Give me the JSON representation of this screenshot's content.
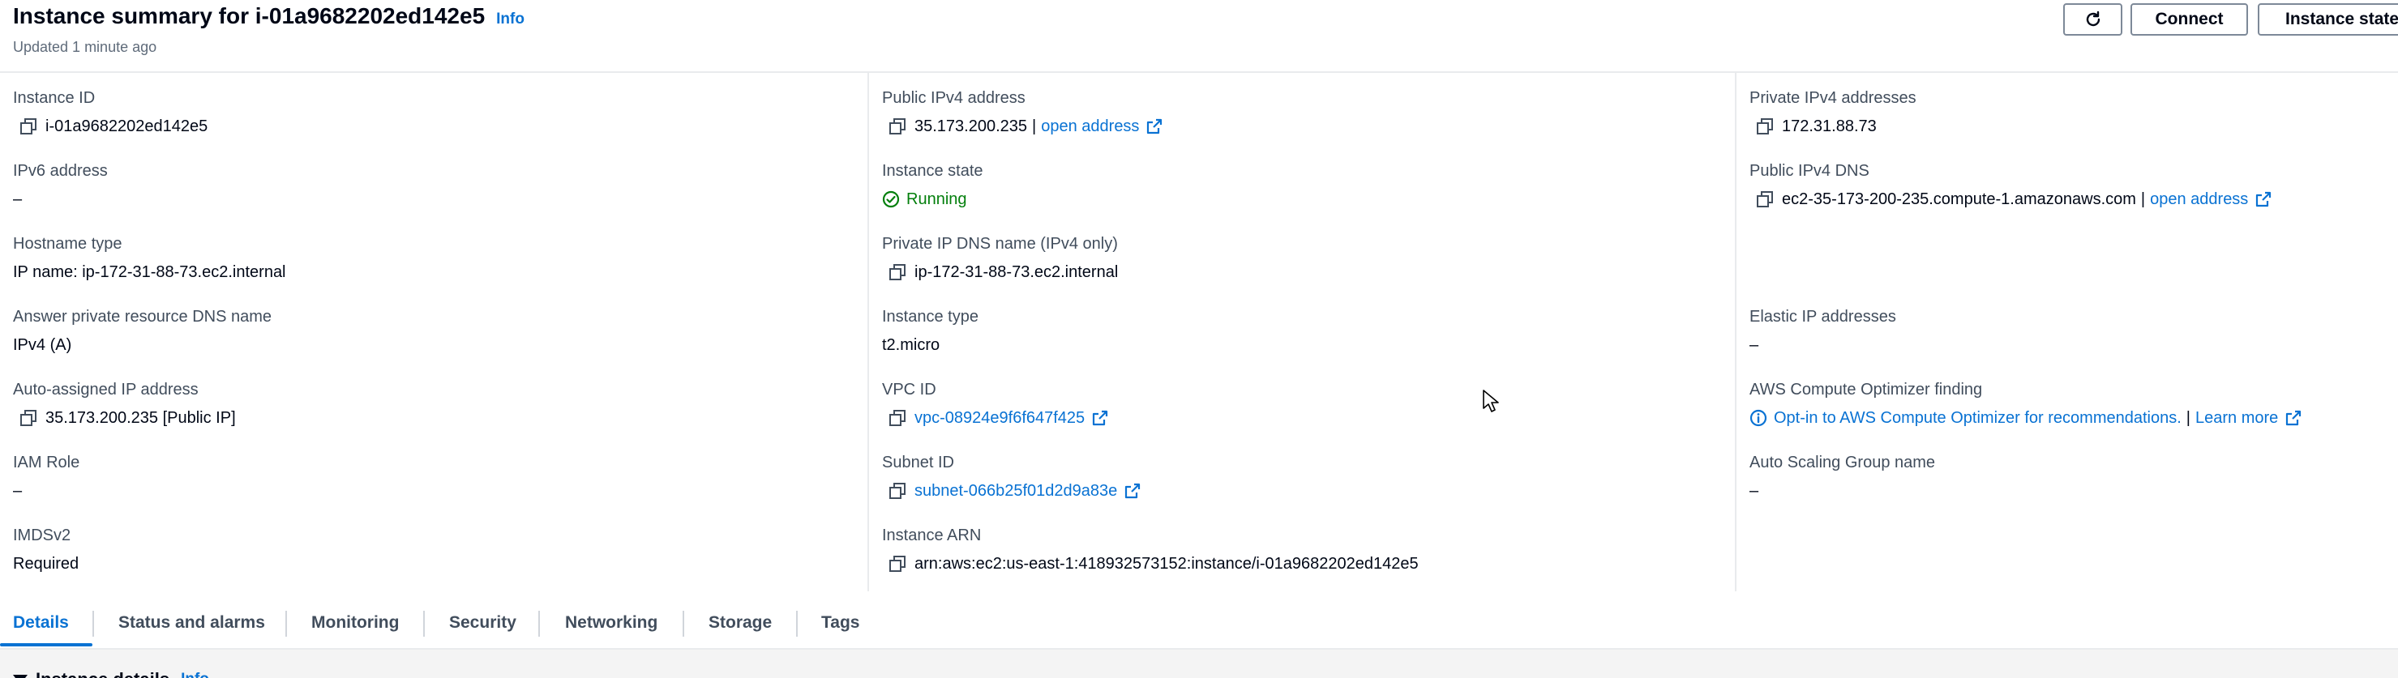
{
  "header": {
    "title": "Instance summary for i-01a9682202ed142e5",
    "info_link": "Info",
    "updated": "Updated 1 minute ago",
    "buttons": {
      "refresh_icon": "refresh-icon",
      "connect": "Connect",
      "instance_state": "Instance state"
    }
  },
  "fields": {
    "instance_id": {
      "label": "Instance ID",
      "value": "i-01a9682202ed142e5"
    },
    "ipv6_address": {
      "label": "IPv6 address",
      "value": "–"
    },
    "hostname_type": {
      "label": "Hostname type",
      "value": "IP name: ip-172-31-88-73.ec2.internal"
    },
    "answer_private_dns": {
      "label": "Answer private resource DNS name",
      "value": "IPv4 (A)"
    },
    "auto_assigned_ip": {
      "label": "Auto-assigned IP address",
      "value": "35.173.200.235 [Public IP]"
    },
    "iam_role": {
      "label": "IAM Role",
      "value": "–"
    },
    "imdsv2": {
      "label": "IMDSv2",
      "value": "Required"
    },
    "public_ipv4": {
      "label": "Public IPv4 address",
      "value": "35.173.200.235",
      "separator": "|",
      "link": "open address"
    },
    "instance_state": {
      "label": "Instance state",
      "value": "Running"
    },
    "private_ip_dns": {
      "label": "Private IP DNS name (IPv4 only)",
      "value": "ip-172-31-88-73.ec2.internal"
    },
    "instance_type": {
      "label": "Instance type",
      "value": "t2.micro"
    },
    "vpc_id": {
      "label": "VPC ID",
      "link": "vpc-08924e9f6f647f425"
    },
    "subnet_id": {
      "label": "Subnet ID",
      "link": "subnet-066b25f01d2d9a83e"
    },
    "instance_arn": {
      "label": "Instance ARN",
      "value": "arn:aws:ec2:us-east-1:418932573152:instance/i-01a9682202ed142e5"
    },
    "private_ipv4": {
      "label": "Private IPv4 addresses",
      "value": "172.31.88.73"
    },
    "public_ipv4_dns": {
      "label": "Public IPv4 DNS",
      "value": "ec2-35-173-200-235.compute-1.amazonaws.com",
      "separator": "|",
      "link": "open address"
    },
    "elastic_ip": {
      "label": "Elastic IP addresses",
      "value": "–"
    },
    "compute_optimizer": {
      "label": "AWS Compute Optimizer finding",
      "link": "Opt-in to AWS Compute Optimizer for recommendations.",
      "separator": "|",
      "learn_more": "Learn more"
    },
    "auto_scaling_group": {
      "label": "Auto Scaling Group name",
      "value": "–"
    }
  },
  "tabs": [
    {
      "label": "Details"
    },
    {
      "label": "Status and alarms"
    },
    {
      "label": "Monitoring"
    },
    {
      "label": "Security"
    },
    {
      "label": "Networking"
    },
    {
      "label": "Storage"
    },
    {
      "label": "Tags"
    }
  ],
  "section": {
    "title": "Instance details",
    "info_link": "Info"
  },
  "colors": {
    "link": "#0972d3",
    "success": "#037f0c",
    "label": "#414d5c",
    "text": "#000716"
  }
}
